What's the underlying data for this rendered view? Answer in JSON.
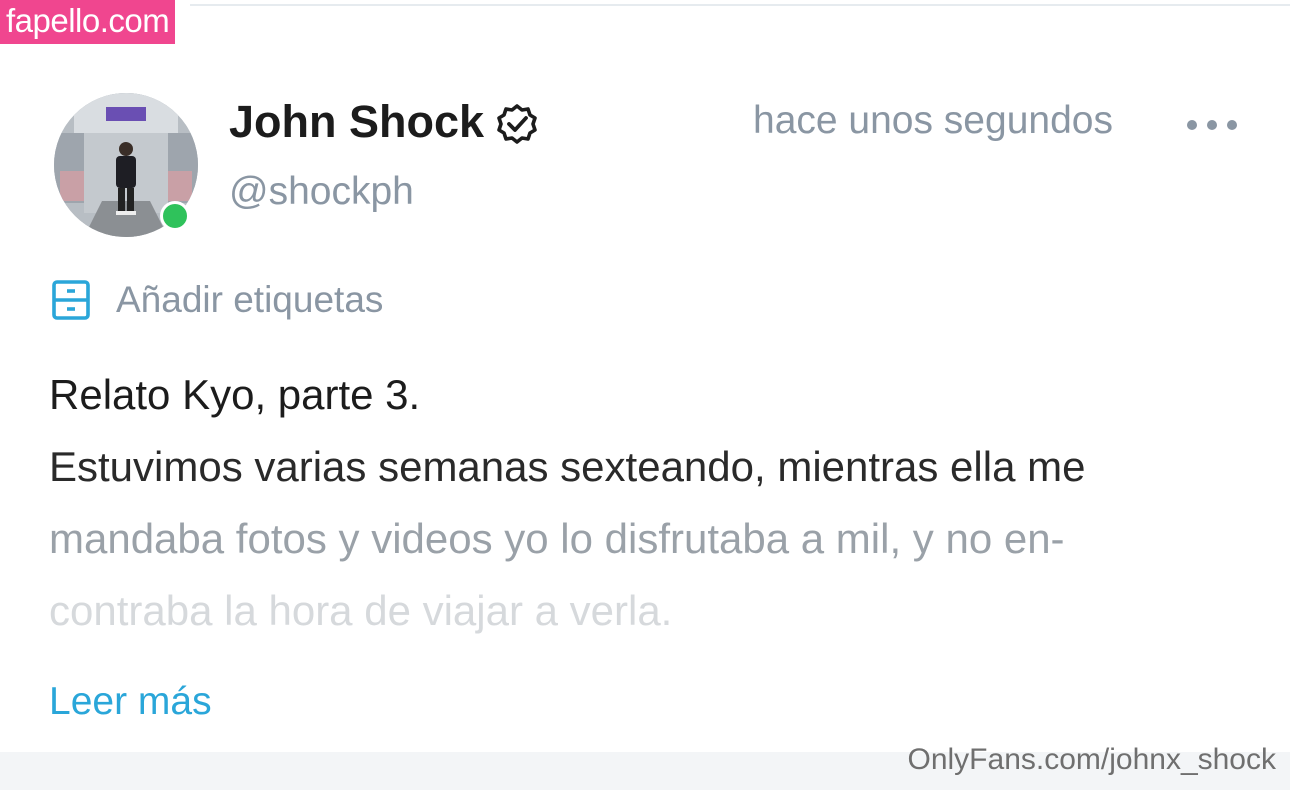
{
  "watermark_top": "fapello.com",
  "watermark_bottom": "OnlyFans.com/johnx_shock",
  "post": {
    "author": {
      "display_name": "John Shock",
      "handle": "@shockph",
      "verified": true,
      "online": true
    },
    "timestamp": "hace unos segundos",
    "tags_action": "Añadir etiquetas",
    "title": "Relato Kyo, parte 3.",
    "body_lines": [
      "Estuvimos varias semanas sexteando, mientras ella me",
      "mandaba fotos y videos yo lo disfrutaba a mil, y no en-",
      "contraba la hora de viajar a verla."
    ],
    "read_more": "Leer más"
  },
  "icons": {
    "verified": "verified-badge-icon",
    "more": "more-options-icon",
    "tags": "tag-list-icon"
  },
  "colors": {
    "watermark_pink": "#f0468f",
    "muted_text": "#8a96a3",
    "accent_blue": "#2aa6d9",
    "online_green": "#2fc25b"
  }
}
